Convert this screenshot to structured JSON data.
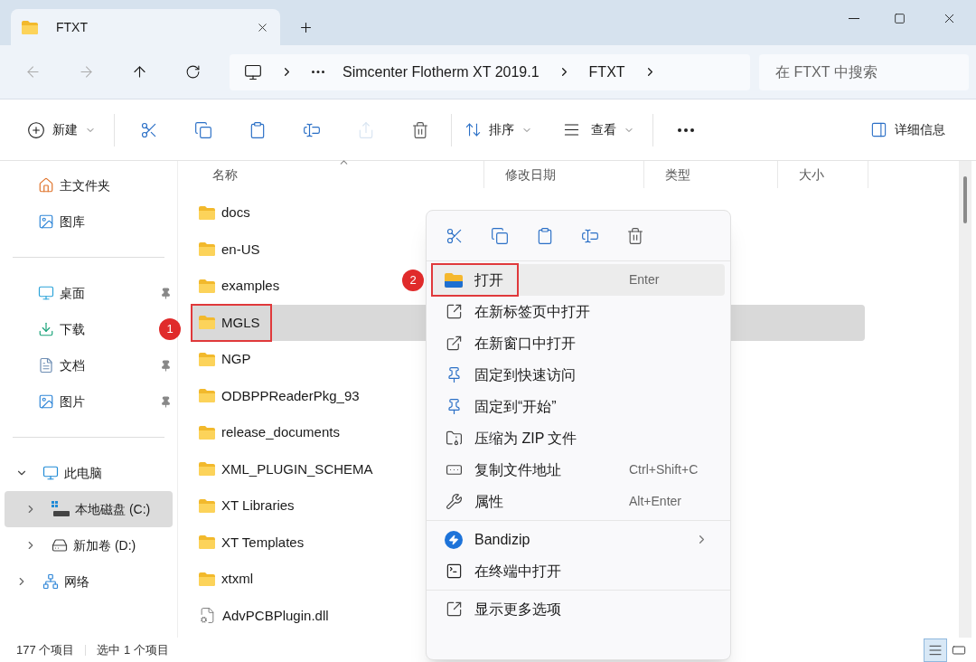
{
  "tab": {
    "title": "FTXT"
  },
  "address": {
    "breadcrumbs": [
      "Simcenter Flotherm XT 2019.1",
      "FTXT"
    ]
  },
  "search": {
    "placeholder": "在 FTXT 中搜索"
  },
  "toolbar": {
    "new": {
      "label": "新建"
    },
    "actions": [
      {
        "kind": "cut",
        "disabled": false
      },
      {
        "kind": "copy",
        "disabled": false
      },
      {
        "kind": "paste",
        "disabled": false
      },
      {
        "kind": "rename",
        "disabled": false
      },
      {
        "kind": "share",
        "disabled": true
      },
      {
        "kind": "delete",
        "disabled": false
      }
    ],
    "sort": {
      "label": "排序"
    },
    "view": {
      "label": "查看"
    },
    "details": {
      "label": "详细信息"
    }
  },
  "sidebar": {
    "top": [
      {
        "label": "主文件夹",
        "kind": "home"
      },
      {
        "label": "图库",
        "kind": "gallery"
      }
    ],
    "quick": [
      {
        "label": "桌面",
        "kind": "desktop",
        "pinned": true
      },
      {
        "label": "下载",
        "kind": "downloads",
        "badge": "1"
      },
      {
        "label": "文档",
        "kind": "documents",
        "pinned": true
      },
      {
        "label": "图片",
        "kind": "pictures",
        "pinned": true
      }
    ],
    "tree": [
      {
        "label": "此电脑",
        "kind": "pc",
        "expanded": true,
        "selected": false,
        "children": [
          {
            "label": "本地磁盘 (C:)",
            "kind": "system-drive",
            "expanded": false,
            "selected": true
          },
          {
            "label": "新加卷 (D:)",
            "kind": "drive",
            "expanded": false,
            "selected": false
          }
        ]
      },
      {
        "label": "网络",
        "kind": "network",
        "expanded": false,
        "selected": false
      }
    ]
  },
  "files": {
    "columns": [
      {
        "label": "名称",
        "sorted": true
      },
      {
        "label": "修改日期",
        "sorted": false
      },
      {
        "label": "类型",
        "sorted": false
      },
      {
        "label": "大小",
        "sorted": false
      }
    ],
    "rows": [
      {
        "name": "docs",
        "kind": "folder",
        "selected": false,
        "highlighted": false
      },
      {
        "name": "en-US",
        "kind": "folder",
        "selected": false,
        "highlighted": false
      },
      {
        "name": "examples",
        "kind": "folder",
        "selected": false,
        "highlighted": false
      },
      {
        "name": "MGLS",
        "kind": "folder",
        "selected": true,
        "highlighted": true
      },
      {
        "name": "NGP",
        "kind": "folder",
        "selected": false,
        "highlighted": false
      },
      {
        "name": "ODBPPReaderPkg_93",
        "kind": "folder",
        "selected": false,
        "highlighted": false
      },
      {
        "name": "release_documents",
        "kind": "folder",
        "selected": false,
        "highlighted": false
      },
      {
        "name": "XML_PLUGIN_SCHEMA",
        "kind": "folder",
        "selected": false,
        "highlighted": false
      },
      {
        "name": "XT Libraries",
        "kind": "folder",
        "selected": false,
        "highlighted": false
      },
      {
        "name": "XT Templates",
        "kind": "folder",
        "selected": false,
        "highlighted": false
      },
      {
        "name": "xtxml",
        "kind": "folder",
        "selected": false,
        "highlighted": false
      },
      {
        "name": "AdvPCBPlugin.dll",
        "kind": "file",
        "selected": false,
        "highlighted": false
      }
    ]
  },
  "context_menu": {
    "quick_actions": [
      {
        "kind": "cut"
      },
      {
        "kind": "copy"
      },
      {
        "kind": "paste"
      },
      {
        "kind": "rename"
      },
      {
        "kind": "delete"
      }
    ],
    "groups": [
      [
        {
          "label": "打开",
          "kind": "open",
          "shortcut": "Enter",
          "selected": true,
          "highlighted": true,
          "badge": "2"
        },
        {
          "label": "在新标签页中打开",
          "kind": "new-tab",
          "selected": false,
          "highlighted": false
        },
        {
          "label": "在新窗口中打开",
          "kind": "new-window",
          "selected": false,
          "highlighted": false
        },
        {
          "label": "固定到快速访问",
          "kind": "pin",
          "selected": false,
          "highlighted": false
        },
        {
          "label": "固定到“开始”",
          "kind": "pin",
          "selected": false,
          "highlighted": false
        },
        {
          "label": "压缩为 ZIP 文件",
          "kind": "zip",
          "selected": false,
          "highlighted": false
        },
        {
          "label": "复制文件地址",
          "kind": "copy-path",
          "shortcut": "Ctrl+Shift+C",
          "selected": false,
          "highlighted": false
        },
        {
          "label": "属性",
          "kind": "properties",
          "shortcut": "Alt+Enter",
          "selected": false,
          "highlighted": false
        }
      ],
      [
        {
          "label": "Bandizip",
          "kind": "bandizip",
          "submenu": true,
          "selected": false,
          "highlighted": false
        },
        {
          "label": "在终端中打开",
          "kind": "terminal",
          "selected": false,
          "highlighted": false
        }
      ],
      [
        {
          "label": "显示更多选项",
          "kind": "more",
          "selected": false,
          "highlighted": false
        }
      ]
    ]
  },
  "status_bar": {
    "count": "177 个项目",
    "selection": "选中 1 个项目",
    "views": [
      {
        "kind": "details",
        "selected": true
      },
      {
        "kind": "tiles",
        "selected": false
      }
    ]
  }
}
